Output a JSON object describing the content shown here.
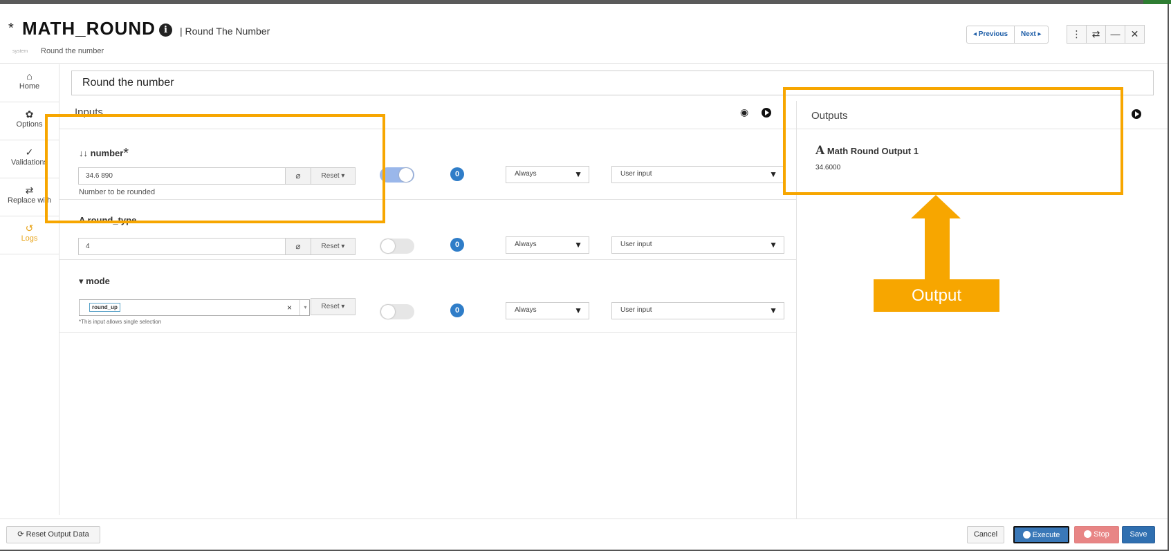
{
  "header": {
    "asterisk": "*",
    "title": "MATH_ROUND",
    "info_icon": "i",
    "subtitle": "| Round The Number",
    "system_label": "system",
    "description": "Round the number",
    "previous_label": "◂ Previous",
    "next_label": "Next ▸",
    "menu_icon": "⋮",
    "swap_icon": "⇄",
    "minimize_icon": "—",
    "close_icon": "✕"
  },
  "sidebar": {
    "items": [
      {
        "label": "Home",
        "icon": "home-icon",
        "glyph": "⌂"
      },
      {
        "label": "Options",
        "icon": "gear-icon",
        "glyph": "✿"
      },
      {
        "label": "Validations",
        "icon": "check-double-icon",
        "glyph": "✓"
      },
      {
        "label": "Replace with",
        "icon": "swap-icon",
        "glyph": "⇄"
      },
      {
        "label": "Logs",
        "icon": "history-icon",
        "glyph": "↺",
        "active": true
      }
    ]
  },
  "main": {
    "description_value": "Round the number",
    "inputs_heading": "Inputs",
    "outputs_heading": "Outputs"
  },
  "inputs": [
    {
      "label": "number",
      "type_glyph": "↓↓",
      "required_mark": "*",
      "value": "34.6 890",
      "reset_label": "Reset ▾",
      "hint": "Number to be rounded",
      "toggle_on": true,
      "badge": "0",
      "condition": "Always",
      "source": "User input"
    },
    {
      "label": "round_type",
      "type_glyph": "A",
      "value": "4",
      "reset_label": "Reset ▾",
      "toggle_on": false,
      "badge": "0",
      "condition": "Always",
      "source": "User input"
    },
    {
      "label": "mode",
      "type_glyph": "▾",
      "value": "round_up",
      "clear_icon": "×",
      "caret": "▾",
      "reset_label": "Reset ▾",
      "hint": "*This input allows single selection",
      "toggle_on": false,
      "badge": "0",
      "condition": "Always",
      "source": "User input"
    }
  ],
  "outputs": [
    {
      "label": "Math Round Output 1",
      "type_glyph": "A",
      "value": "34.6000"
    }
  ],
  "footer": {
    "reset_output_label": "Reset Output Data",
    "cancel_label": "Cancel",
    "execute_label": "Execute",
    "stop_label": "Stop",
    "save_label": "Save"
  },
  "annotation": {
    "label": "Output",
    "color": "#f7a600"
  },
  "colors": {
    "accent_blue": "#2f6fb0",
    "active_tab": "#e8a317",
    "stop_red": "#e88585"
  }
}
